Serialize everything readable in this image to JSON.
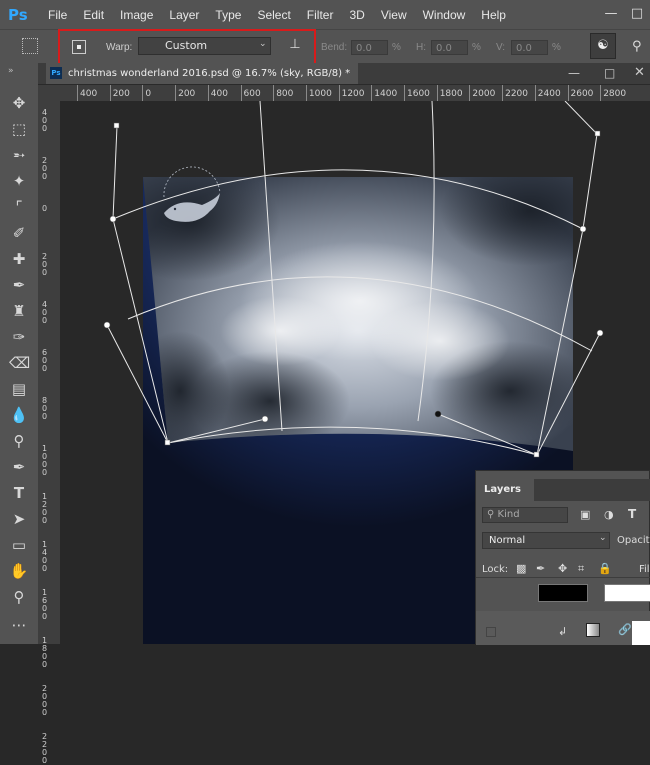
{
  "menu": {
    "logo": "Ps",
    "items": [
      "File",
      "Edit",
      "Image",
      "Layer",
      "Type",
      "Select",
      "Filter",
      "3D",
      "View",
      "Window",
      "Help"
    ]
  },
  "options": {
    "warp_label": "Warp:",
    "warp_value": "Custom",
    "bend_label": "Bend:",
    "bend_value": "0.0",
    "bend_unit": "%",
    "h_label": "H:",
    "h_value": "0.0",
    "h_unit": "%",
    "v_label": "V:",
    "v_value": "0.0",
    "v_unit": "%"
  },
  "document": {
    "tab_title": "christmas wonderland 2016.psd @ 16.7% (sky, RGB/8) *"
  },
  "ruler": {
    "top_ticks": [
      "400",
      "200",
      "0",
      "200",
      "400",
      "600",
      "800",
      "1000",
      "1200",
      "1400",
      "1600",
      "1800",
      "2000",
      "2200",
      "2400",
      "2600",
      "2800"
    ],
    "left_ticks": [
      "4 0 0",
      "2 0 0",
      "0",
      "2 0 0",
      "4 0 0",
      "6 0 0",
      "8 0 0",
      "1 0 0 0",
      "1 2 0 0",
      "1 4 0 0",
      "1 6 0 0",
      "1 8 0 0",
      "2 0 0 0",
      "2 2 0 0"
    ]
  },
  "layers": {
    "tab": "Layers",
    "kind_label": "Kind",
    "blend_mode": "Normal",
    "opacity_label": "Opacity",
    "lock_label": "Lock:",
    "fill_label": "Fill"
  },
  "colors": {
    "highlight": "#d81b1b",
    "ps_blue": "#31a8ff"
  }
}
